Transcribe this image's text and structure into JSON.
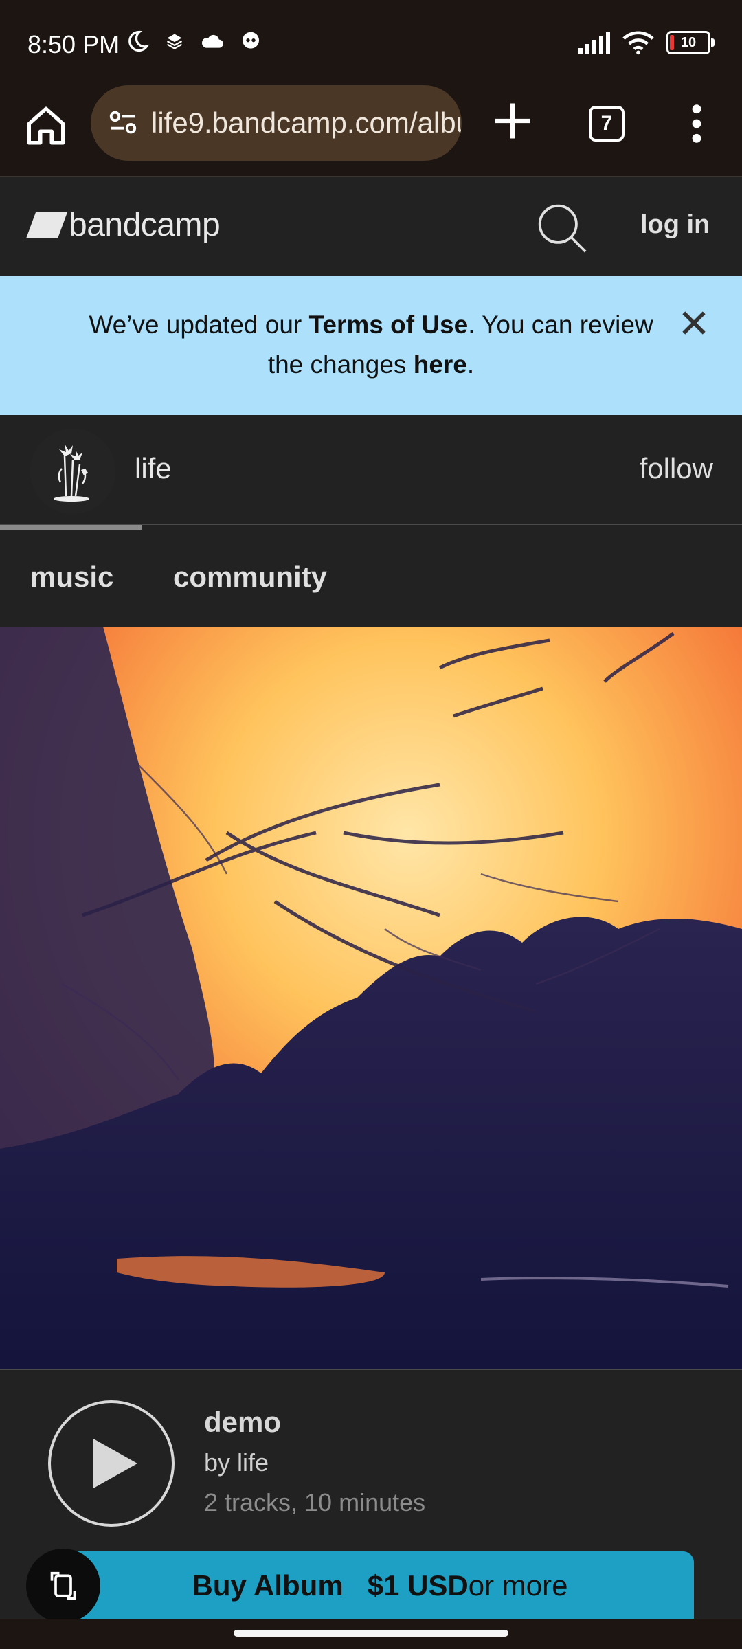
{
  "status_bar": {
    "time": "8:50 PM",
    "battery_level": "10",
    "icons": [
      "moon-icon",
      "layers-icon",
      "cloud-icon",
      "chat-icon",
      "signal-icon",
      "wifi-icon",
      "battery-icon"
    ]
  },
  "browser": {
    "url": "life9.bandcamp.com/album",
    "tab_count": "7",
    "icons": [
      "home-icon",
      "site-settings-icon",
      "new-tab-icon",
      "tabs-icon",
      "more-menu-icon"
    ]
  },
  "header": {
    "logo_text": "bandcamp",
    "login_label": "log in"
  },
  "notice": {
    "part1": "We’ve updated our ",
    "terms_link": "Terms of Use",
    "part2": ". You can review the changes ",
    "here_link": "here",
    "part3": "."
  },
  "artist": {
    "name": "life",
    "follow_label": "follow"
  },
  "tabs": [
    {
      "label": "music"
    },
    {
      "label": "community"
    }
  ],
  "album": {
    "title": "demo",
    "by_line": "by life",
    "meta": "2 tracks, 10 minutes"
  },
  "buy": {
    "label": "Buy Album",
    "price": "$1 USD",
    "suffix": " or more"
  },
  "colors": {
    "banner": "#ace0fb",
    "buy_button": "#1da0c3",
    "page_bg": "#222222",
    "browser_bar": "#1d1511"
  }
}
